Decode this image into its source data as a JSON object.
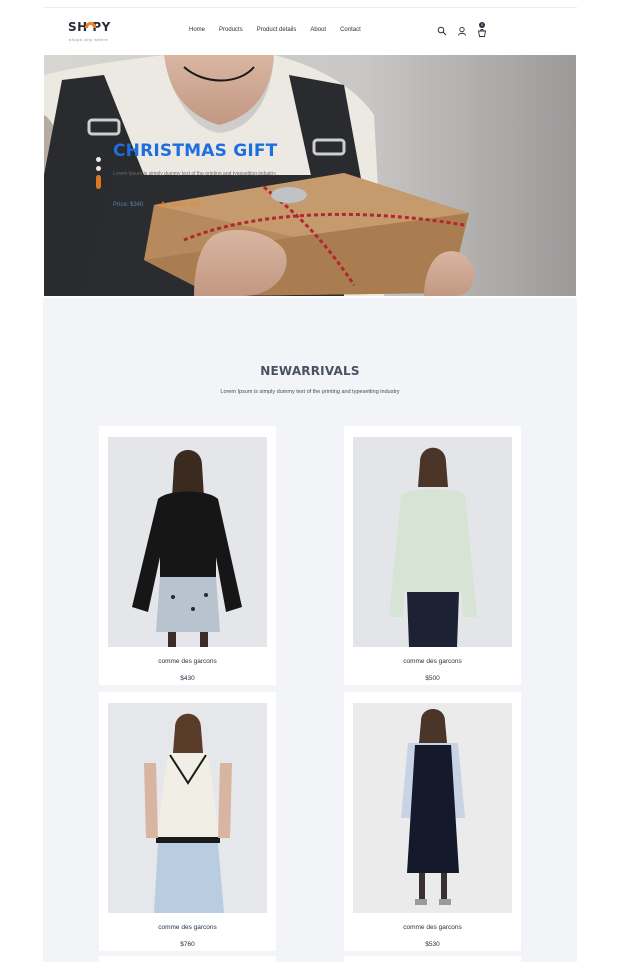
{
  "brand": {
    "logo_text": "SH  PY",
    "tagline": "shops any where",
    "accent_color": "#f07f22"
  },
  "nav": {
    "items": [
      "Home",
      "Products",
      "Product details",
      "About",
      "Contact"
    ]
  },
  "header_icons": {
    "search": "search-icon",
    "account": "user-icon",
    "cart": "cart-icon",
    "cart_count": "0"
  },
  "hero": {
    "title": "CHRISTMAS GIFT",
    "subtitle": "Lorem Ipsum is simply dummy text of the printing and typesetting industry",
    "price": "Price: $340",
    "cart_label": "Add to cart",
    "title_color": "#1d6fe0"
  },
  "arrivals": {
    "title": "NEWARRIVALS",
    "subtitle": "Lorem Ipsum is simply dummy text of the printing and typesetting industry",
    "products": [
      {
        "name": "comme des garcons",
        "price": "$430"
      },
      {
        "name": "comme des garcons",
        "price": "$500"
      },
      {
        "name": "comme des garcons",
        "price": "$760"
      },
      {
        "name": "comme des garcons",
        "price": "$530"
      }
    ]
  }
}
